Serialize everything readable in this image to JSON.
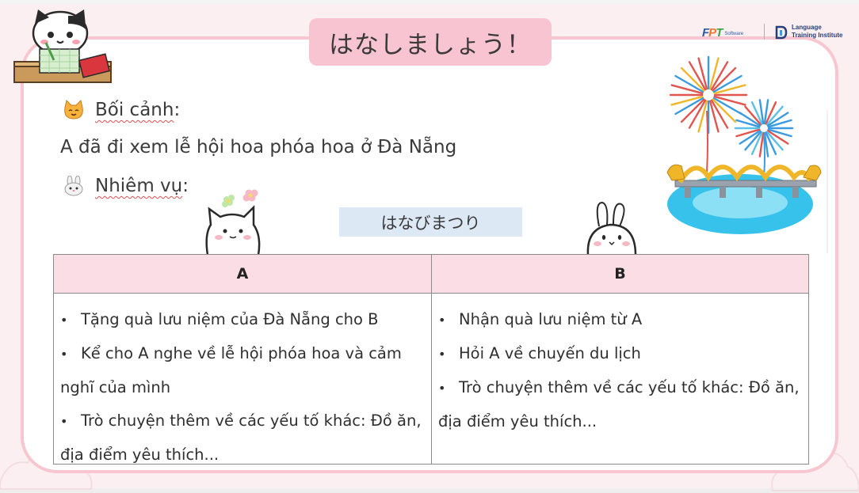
{
  "title": "はなしましょう！",
  "logos": {
    "fpt_letters": [
      "F",
      "P",
      "T"
    ],
    "fpt_sub": "Software",
    "lti_line1": "Language",
    "lti_line2": "Training Institute"
  },
  "context": {
    "label": "Bối cảnh",
    "colon": ":",
    "text": "A đã đi xem lễ hội hoa phóa hoa ở Đà Nẵng"
  },
  "task": {
    "label": "Nhiêm vụ",
    "colon": ":"
  },
  "keyword": "はなびまつり",
  "table": {
    "bullet": "•",
    "col_a": {
      "header": "A",
      "items": [
        "Tặng quà lưu niệm của Đà Nẵng cho B",
        "Kể cho A nghe về lễ hội phóa hoa và cảm nghĩ của mình",
        "Trò chuyện thêm về các yếu tố khác: Đồ ăn, địa điểm yêu thích..."
      ]
    },
    "col_b": {
      "header": "B",
      "items": [
        "Nhận quà lưu niệm từ A",
        "Hỏi A về chuyến du lịch",
        "Trò chuyện thêm về các yếu tố khác: Đồ ăn, địa điểm yêu thích..."
      ]
    }
  },
  "colors": {
    "frame_border": "#f8c6d0",
    "title_badge": "#f9c4d2",
    "table_header": "#fbdde5",
    "keyword_box": "#dde8f5",
    "fpt_f": "#2b5aa6",
    "fpt_p": "#f0762e",
    "fpt_t": "#3aa14a",
    "firework_red": "#e2554f",
    "firework_blue": "#3a9be0",
    "water": "#36c2ea"
  }
}
